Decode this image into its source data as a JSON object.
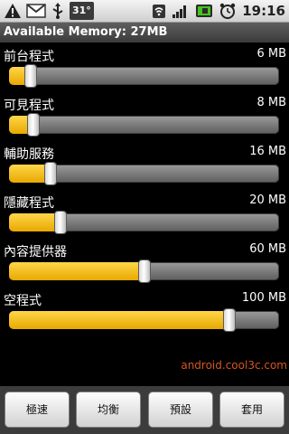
{
  "status_bar": {
    "temperature": "31°",
    "time": "19:16",
    "icons": [
      "warning-icon",
      "gmail-icon",
      "usb-icon",
      "temperature-icon",
      "wifi-icon",
      "signal-icon",
      "battery-icon",
      "alarm-icon"
    ]
  },
  "header": {
    "title": "Available Memory: 27MB"
  },
  "rows": [
    {
      "label": "前台程式",
      "value": "6 MB",
      "level": 0.08
    },
    {
      "label": "可見程式",
      "value": "8 MB",
      "level": 0.09
    },
    {
      "label": "輔助服務",
      "value": "16 MB",
      "level": 0.155
    },
    {
      "label": "隱藏程式",
      "value": "20 MB",
      "level": 0.19
    },
    {
      "label": "內容提供器",
      "value": "60 MB",
      "level": 0.5
    },
    {
      "label": "空程式",
      "value": "100 MB",
      "level": 0.815
    }
  ],
  "watermark": "android.cool3c.com",
  "buttons": [
    "極速",
    "均衡",
    "預設",
    "套用"
  ],
  "colors": {
    "accent": "#f2b800",
    "watermark": "#d6561f"
  }
}
